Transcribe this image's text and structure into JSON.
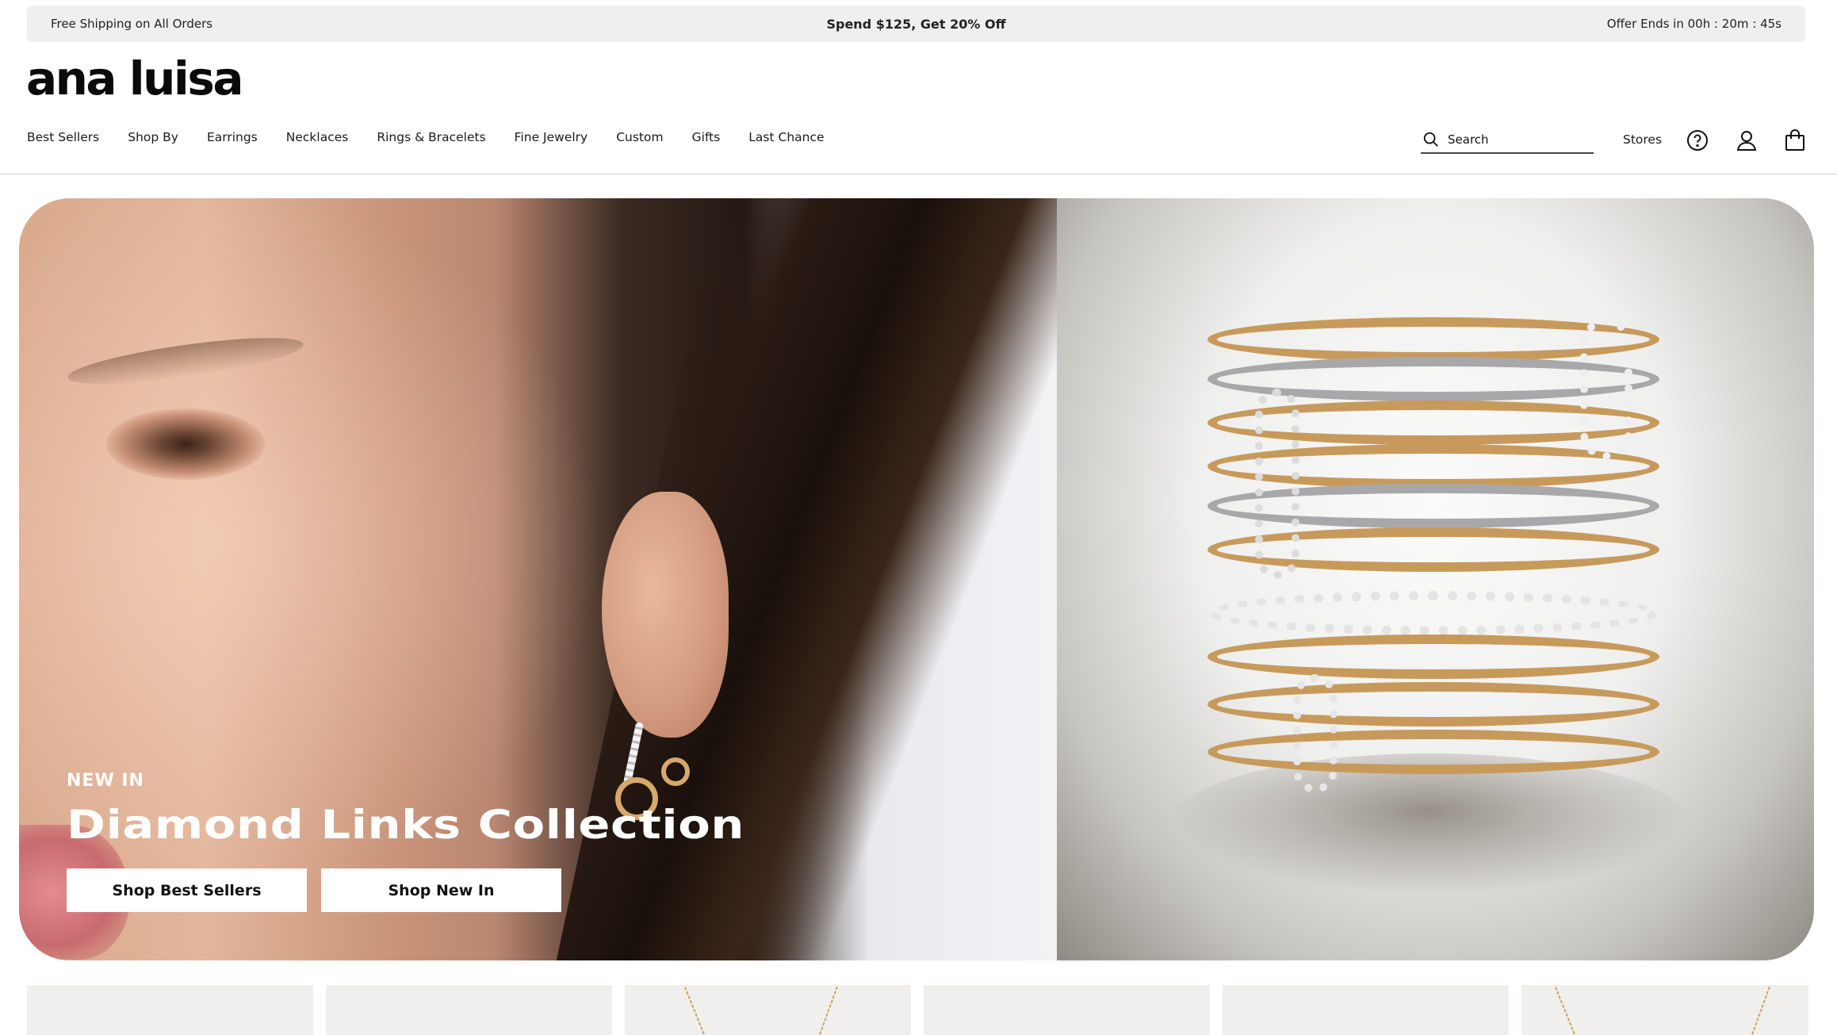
{
  "announcement": {
    "left": "Free Shipping on All Orders",
    "center": "Spend $125, Get 20% Off",
    "right": "Offer Ends in 00h : 20m : 45s"
  },
  "brand": {
    "logo_text": "ana luisa"
  },
  "nav": {
    "items": [
      {
        "label": "Best Sellers"
      },
      {
        "label": "Shop By"
      },
      {
        "label": "Earrings"
      },
      {
        "label": "Necklaces"
      },
      {
        "label": "Rings & Bracelets"
      },
      {
        "label": "Fine Jewelry"
      },
      {
        "label": "Custom"
      },
      {
        "label": "Gifts"
      },
      {
        "label": "Last Chance"
      }
    ]
  },
  "header_actions": {
    "search_placeholder": "Search",
    "stores_label": "Stores",
    "icons": [
      "search-icon",
      "help-icon",
      "account-icon",
      "bag-icon"
    ]
  },
  "hero": {
    "kicker": "NEW IN",
    "headline": "Diamond Links Collection",
    "cta_primary": "Shop Best Sellers",
    "cta_secondary": "Shop New In"
  },
  "colors": {
    "announcement_bg": "#efefef",
    "text": "#111111",
    "accent_gold": "#c79a5c"
  }
}
